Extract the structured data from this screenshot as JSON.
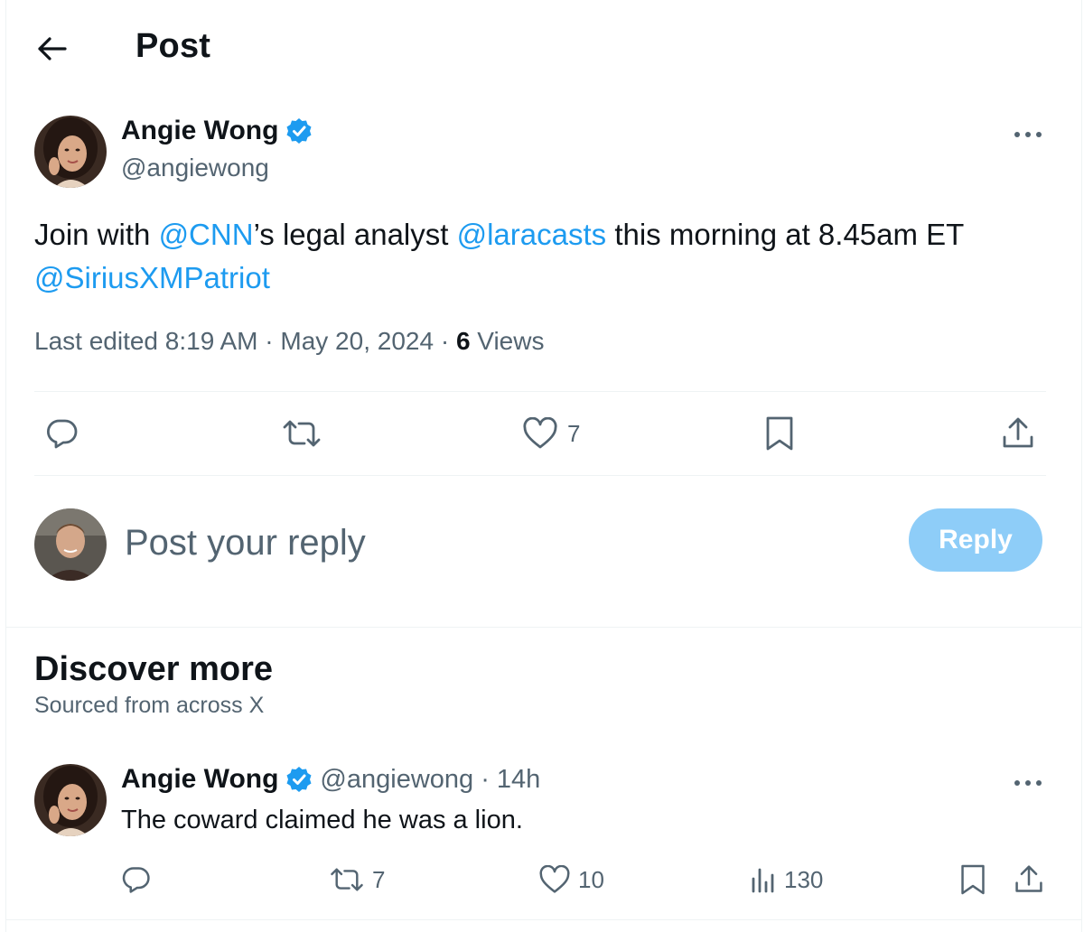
{
  "header": {
    "title": "Post"
  },
  "post": {
    "author_name": "Angie Wong",
    "author_handle": "@angiewong",
    "text_parts": {
      "p1": "Join with ",
      "m1": "@CNN",
      "p2": "’s legal analyst ",
      "m2": "@laracasts",
      "p3": " this morning at 8.45am ET",
      "m3": "@SiriusXMPatriot"
    },
    "meta": {
      "edited": "Last edited 8:19 AM · May 20, 2024 · ",
      "views_count": "6",
      "views_label": " Views"
    },
    "likes": "7"
  },
  "reply": {
    "placeholder": "Post your reply",
    "button": "Reply"
  },
  "discover": {
    "title": "Discover more",
    "subtitle": "Sourced from across X"
  },
  "related_tweet": {
    "author_name": "Angie Wong",
    "handle_time": "@angiewong · 14h",
    "text": "The coward claimed he was a lion.",
    "retweets": "7",
    "likes": "10",
    "views": "130"
  },
  "colors": {
    "accent": "#1d9bf0",
    "reply_button": "#8ecdf8",
    "muted": "#536471"
  },
  "icons": [
    "back-arrow-icon",
    "verified-badge-icon",
    "more-icon",
    "reply-icon",
    "retweet-icon",
    "like-icon",
    "bookmark-icon",
    "share-icon",
    "views-icon"
  ]
}
